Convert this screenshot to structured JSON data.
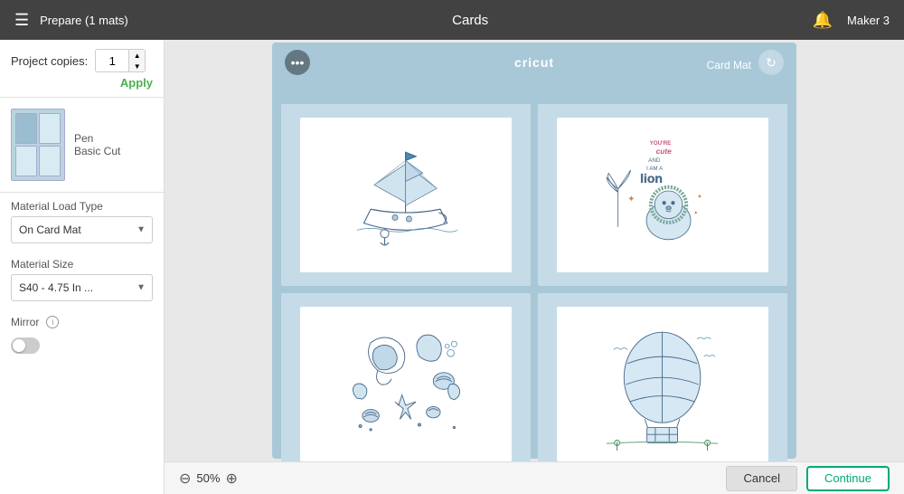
{
  "header": {
    "menu_icon": "☰",
    "title": "Prepare (1 mats)",
    "center_title": "Cards",
    "bell_icon": "🔔",
    "machine": "Maker 3"
  },
  "sidebar": {
    "copies_label": "Project copies:",
    "copies_value": "1",
    "apply_label": "Apply",
    "mat_pen": "Pen",
    "mat_cut": "Basic Cut",
    "material_load_label": "Material Load Type",
    "material_load_value": "On Card Mat",
    "material_size_label": "Material Size",
    "material_size_value": "S40 - 4.75 In ...",
    "mirror_label": "Mirror",
    "info_icon": "i"
  },
  "mat": {
    "menu_icon": "•••",
    "logo": "cricut",
    "refresh_icon": "↻",
    "type_label": "Card Mat"
  },
  "bottom": {
    "zoom_minus": "⊖",
    "zoom_value": "50%",
    "zoom_plus": "⊕",
    "cancel_label": "Cancel",
    "continue_label": "Continue"
  }
}
